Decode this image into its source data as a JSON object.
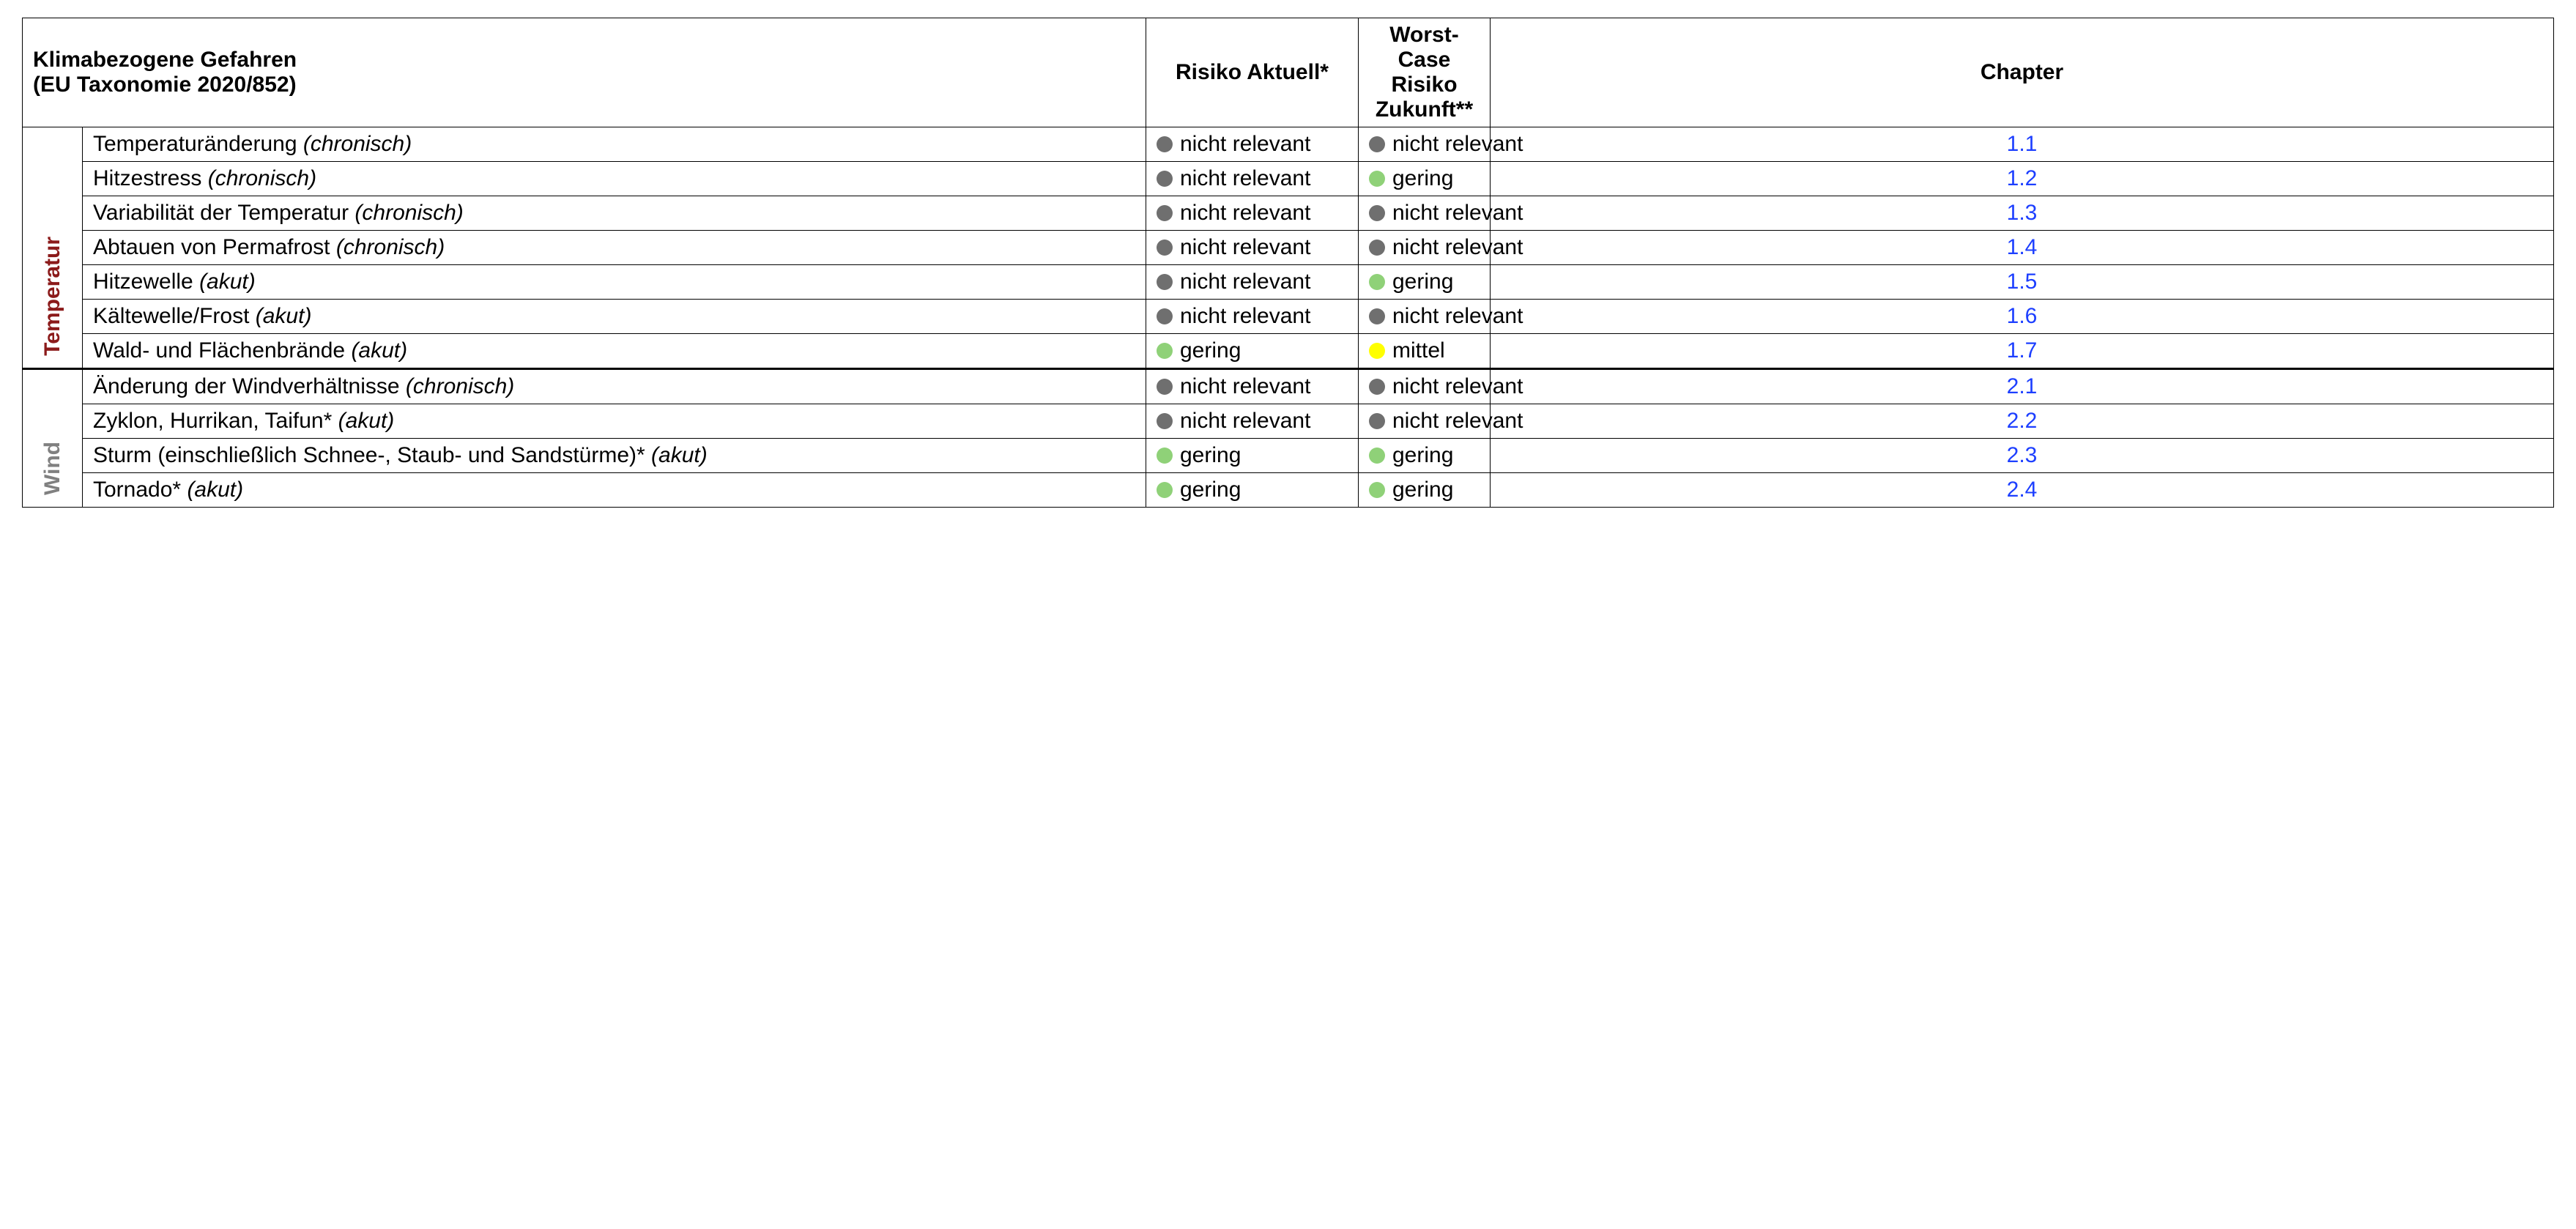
{
  "headers": {
    "hazard_line1": "Klimabezogene Gefahren",
    "hazard_line2": "(EU Taxonomie 2020/852)",
    "risk_current": "Risiko Aktuell*",
    "risk_future_line1": "Worst-Case",
    "risk_future_line2": "Risiko",
    "risk_future_line3": "Zukunft**",
    "chapter": "Chapter"
  },
  "risk_labels": {
    "nicht_relevant": "nicht relevant",
    "gering": "gering",
    "mittel": "mittel"
  },
  "categories": [
    {
      "id": "temperatur",
      "label": "Temperatur",
      "css": "cat-temp",
      "rows": [
        {
          "name": "Temperaturänderung",
          "type": "(chronisch)",
          "current": "nicht_relevant",
          "future": "nicht_relevant",
          "chapter": "1.1"
        },
        {
          "name": "Hitzestress",
          "type": "(chronisch)",
          "current": "nicht_relevant",
          "future": "gering",
          "chapter": "1.2"
        },
        {
          "name": "Variabilität der Temperatur",
          "type": "(chronisch)",
          "current": "nicht_relevant",
          "future": "nicht_relevant",
          "chapter": "1.3"
        },
        {
          "name": "Abtauen von Permafrost",
          "type": "(chronisch)",
          "current": "nicht_relevant",
          "future": "nicht_relevant",
          "chapter": "1.4"
        },
        {
          "name": "Hitzewelle",
          "type": "(akut)",
          "current": "nicht_relevant",
          "future": "gering",
          "chapter": "1.5"
        },
        {
          "name": "Kältewelle/Frost",
          "type": "(akut)",
          "current": "nicht_relevant",
          "future": "nicht_relevant",
          "chapter": "1.6"
        },
        {
          "name": "Wald- und Flächenbrände",
          "type": "(akut)",
          "current": "gering",
          "future": "mittel",
          "chapter": "1.7"
        }
      ]
    },
    {
      "id": "wind",
      "label": "Wind",
      "css": "cat-wind",
      "rows": [
        {
          "name": "Änderung der Windverhältnisse",
          "type": "(chronisch)",
          "current": "nicht_relevant",
          "future": "nicht_relevant",
          "chapter": "2.1"
        },
        {
          "name": "Zyklon, Hurrikan, Taifun*",
          "type": "(akut)",
          "current": "nicht_relevant",
          "future": "nicht_relevant",
          "chapter": "2.2"
        },
        {
          "name": "Sturm (einschließlich Schnee-, Staub- und Sandstürme)*",
          "type": "(akut)",
          "current": "gering",
          "future": "gering",
          "chapter": "2.3"
        },
        {
          "name": "Tornado*",
          "type": "(akut)",
          "current": "gering",
          "future": "gering",
          "chapter": "2.4"
        }
      ]
    }
  ],
  "dot_class": {
    "nicht_relevant": "dot-grey",
    "gering": "dot-green",
    "mittel": "dot-yellow"
  }
}
